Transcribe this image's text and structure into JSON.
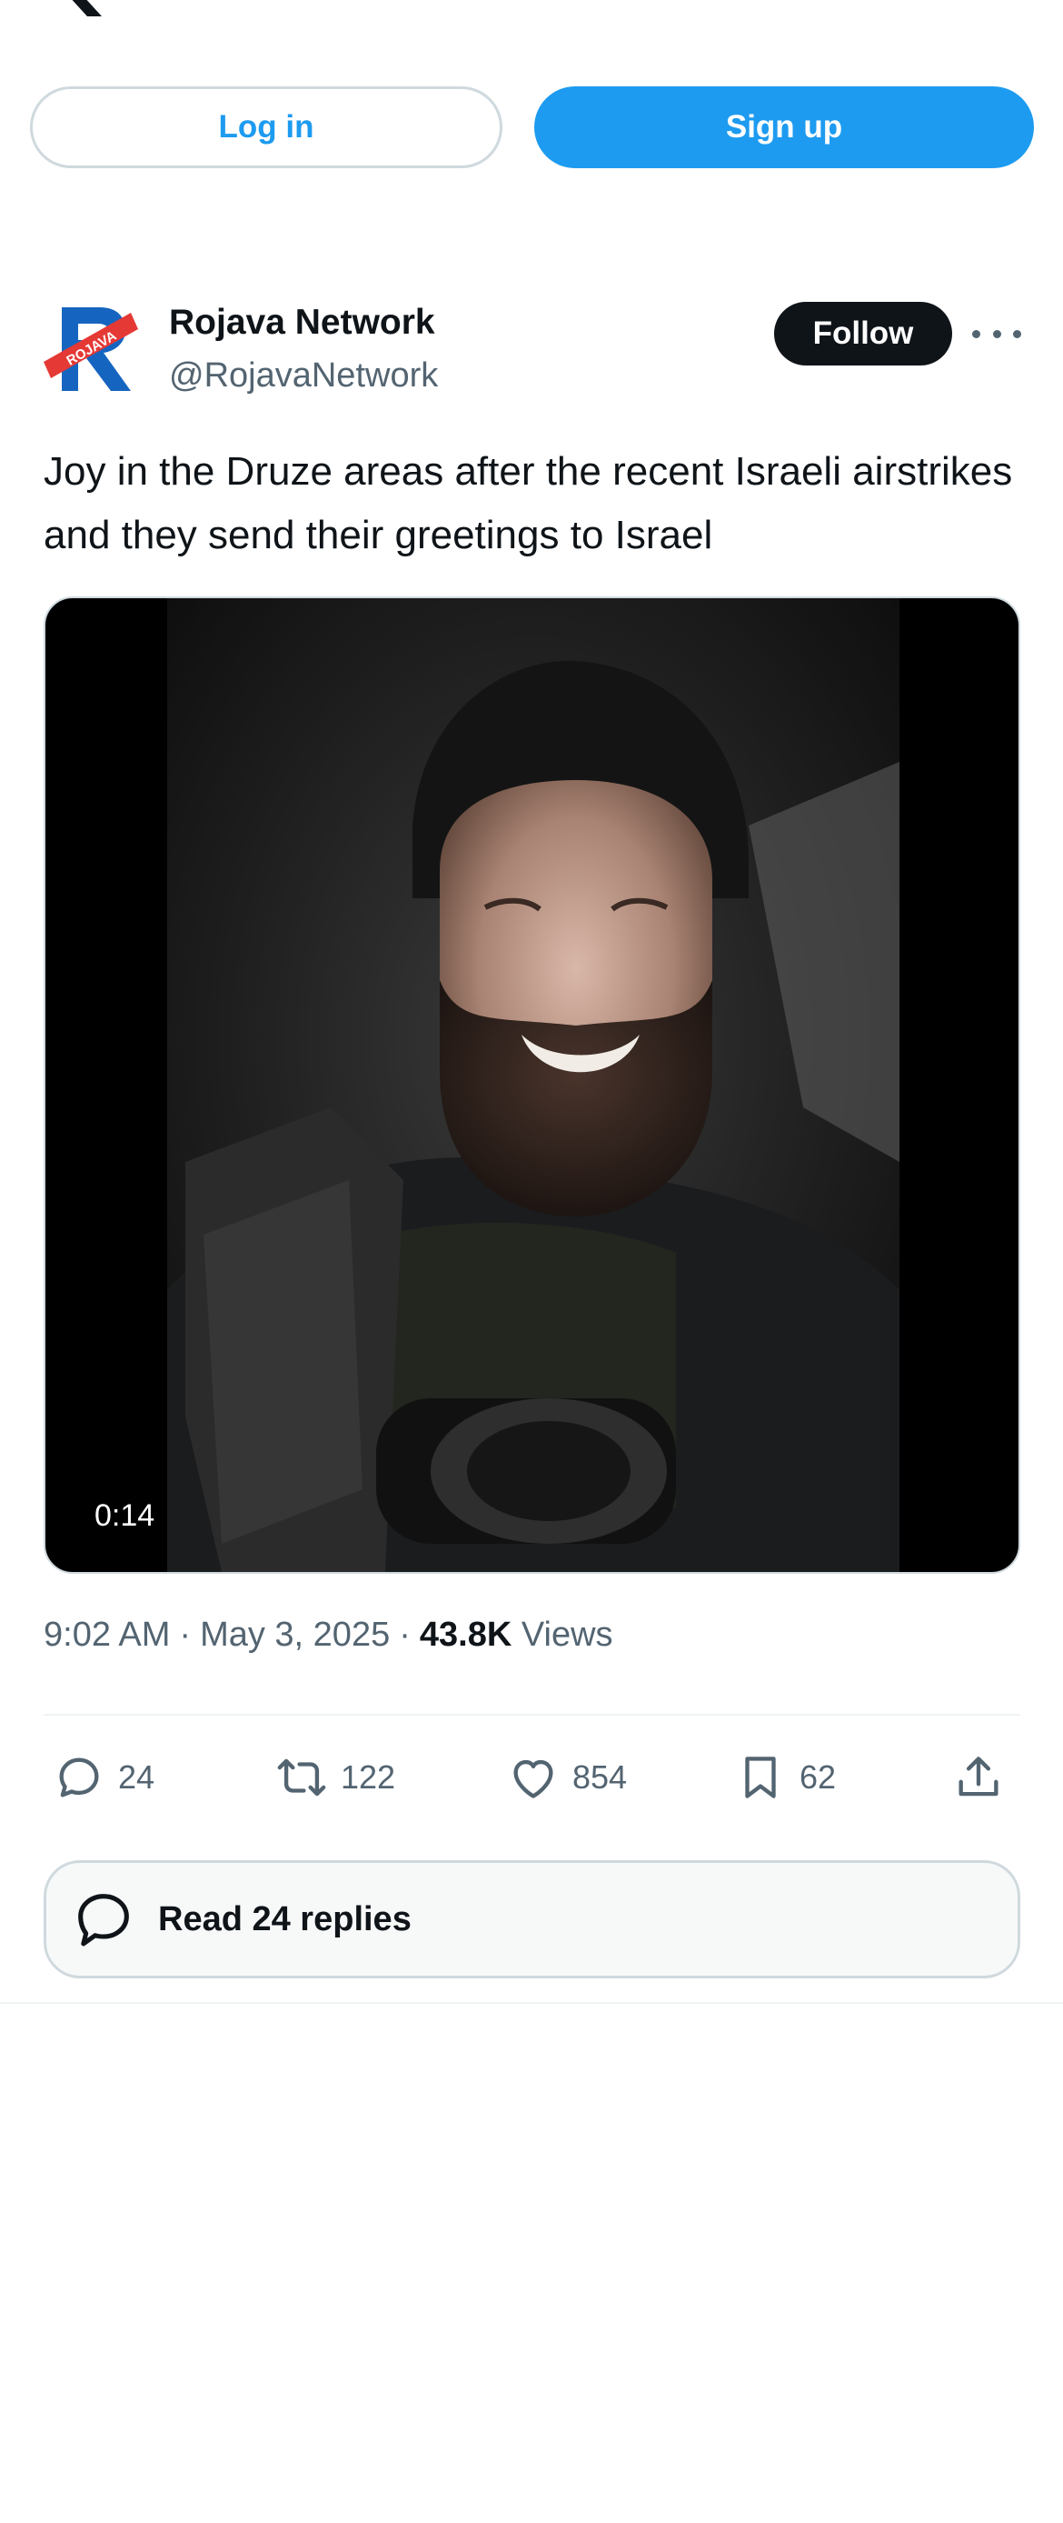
{
  "header": {
    "logo_icon": "x-logo-icon"
  },
  "auth": {
    "login_label": "Log in",
    "signup_label": "Sign up"
  },
  "tweet": {
    "author": {
      "display_name": "Rojava Network",
      "handle": "@RojavaNetwork",
      "avatar_text": "ROJAVA",
      "avatar_icon": "rojava-network-logo"
    },
    "follow_label": "Follow",
    "more_icon": "more-icon",
    "text": "Joy in the Druze areas after the recent Israeli airstrikes and they send their greetings to Israel",
    "media": {
      "type": "video",
      "duration": "0:14"
    },
    "time": "9:02 AM",
    "date": "May 3, 2025",
    "views_count": "43.8K",
    "views_label": "Views",
    "separator": "·",
    "stats": {
      "replies": "24",
      "reposts": "122",
      "likes": "854",
      "bookmarks": "62"
    },
    "read_replies_label": "Read 24 replies"
  },
  "colors": {
    "accent": "#1d9bf0",
    "text": "#0f1419",
    "secondary_text": "#536471",
    "border": "#cfd9de",
    "avatar_red": "#e53935",
    "avatar_blue": "#1565c0"
  }
}
